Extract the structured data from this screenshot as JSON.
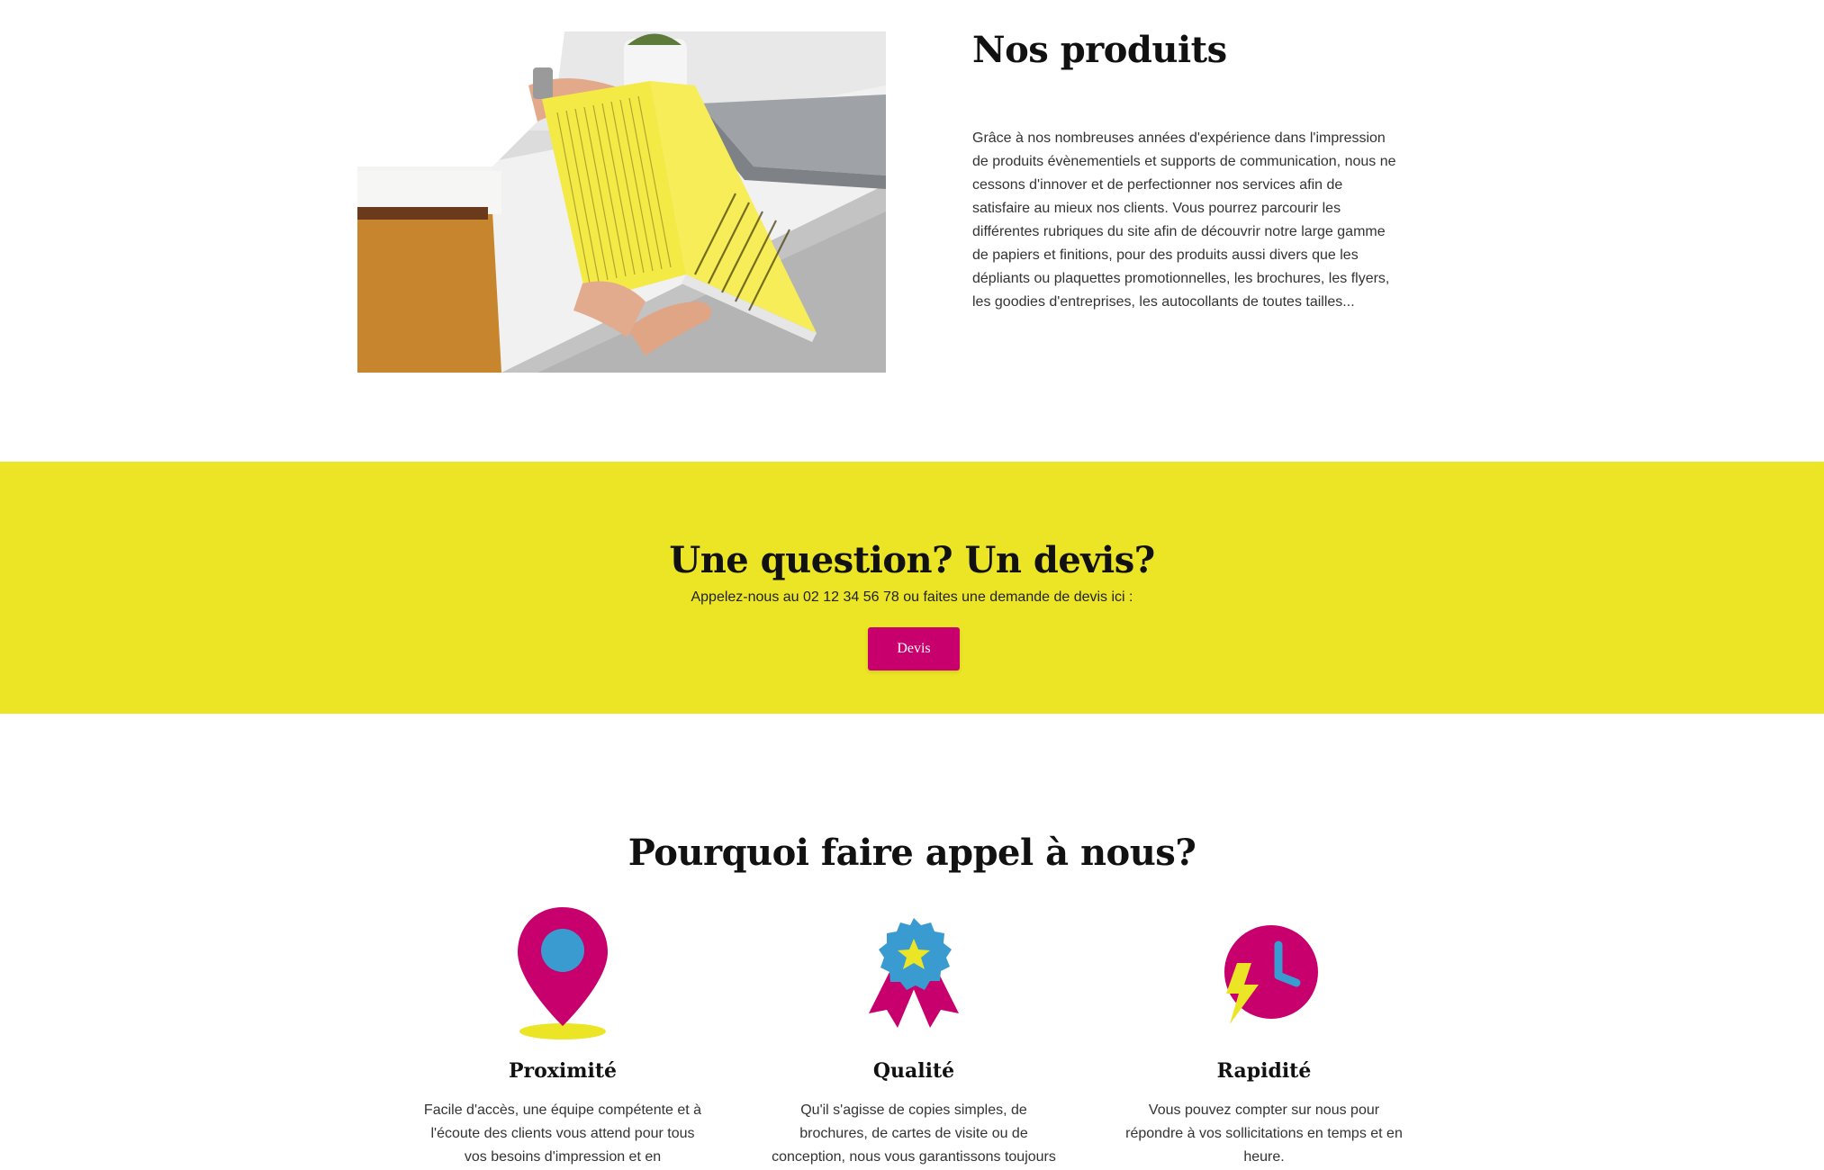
{
  "products": {
    "title": "Nos produits",
    "body": "Grâce à nos nombreuses années d'expérience dans l'impression de produits évènementiels et supports de communication, nous ne cessons d'innover et de perfectionner nos services afin de satisfaire au mieux nos clients. Vous pourrez parcourir les différentes rubriques du site afin de découvrir notre large gamme de papiers et finitions, pour des produits aussi divers que les dépliants ou plaquettes promotionnelles, les brochures, les flyers, les goodies d'entreprises, les autocollants de toutes tailles...",
    "photo_icon": "person-reading-yellow-brochure-photo"
  },
  "cta": {
    "title": "Une question? Un devis?",
    "text": "Appelez-nous au 02 12 34 56 78 ou faites une demande de devis ici :",
    "button_label": "Devis",
    "background_color": "#ece525",
    "button_color": "#c8006d"
  },
  "why": {
    "title": "Pourquoi faire appel à nous?",
    "features": [
      {
        "icon": "map-pin-icon",
        "title": "Proximité",
        "text": "Facile d'accès, une équipe compétente et à l'écoute des clients vous attend pour tous vos besoins d'impression et en"
      },
      {
        "icon": "award-badge-icon",
        "title": "Qualité",
        "text": "Qu'il s'agisse de copies simples, de brochures, de cartes de visite ou de conception, nous vous garantissons toujours"
      },
      {
        "icon": "fast-clock-icon",
        "title": "Rapidité",
        "text": "Vous pouvez compter sur nous pour répondre à vos sollicitations en temps et en heure."
      }
    ]
  },
  "colors": {
    "magenta": "#c8006d",
    "yellow": "#ece525",
    "blue": "#3a9bd0"
  }
}
